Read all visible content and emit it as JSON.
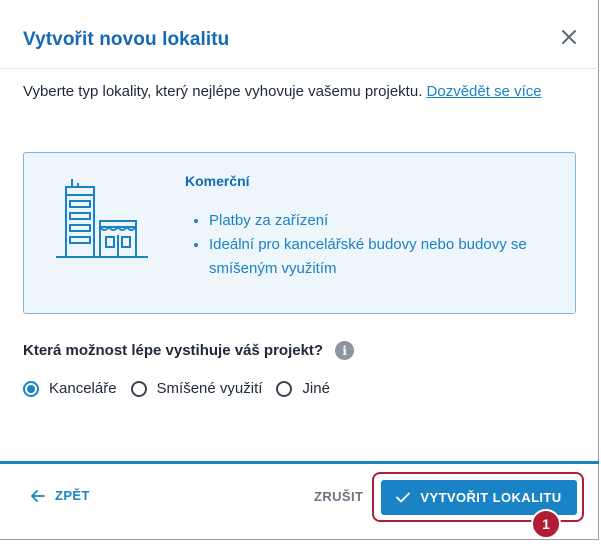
{
  "dialog": {
    "title": "Vytvořit novou lokalitu",
    "close_icon": "close-icon"
  },
  "intro": {
    "text": "Vyberte typ lokality, který nejlépe vyhovuje vašemu projektu. ",
    "link": "Dozvědět se více"
  },
  "card": {
    "icon": "building-icon",
    "title": "Komerční",
    "bullets": [
      "Platby za zařízení",
      "Ideální pro kancelářské budovy nebo budovy se smíšeným využitím"
    ]
  },
  "question": {
    "label": "Která možnost lépe vystihuje váš projekt?",
    "info_icon": "info-icon",
    "info_glyph": "i"
  },
  "options": [
    {
      "label": "Kanceláře",
      "selected": true
    },
    {
      "label": "Smíšené využití",
      "selected": false
    },
    {
      "label": "Jiné",
      "selected": false
    }
  ],
  "footer": {
    "back_label": "ZPĚT",
    "cancel_label": "ZRUŠIT",
    "create_label": "VYTVOŘIT LOKALITU",
    "step_number": "1"
  },
  "colors": {
    "accent": "#1a83c6",
    "title": "#1469b5",
    "highlight": "#b01e35"
  }
}
